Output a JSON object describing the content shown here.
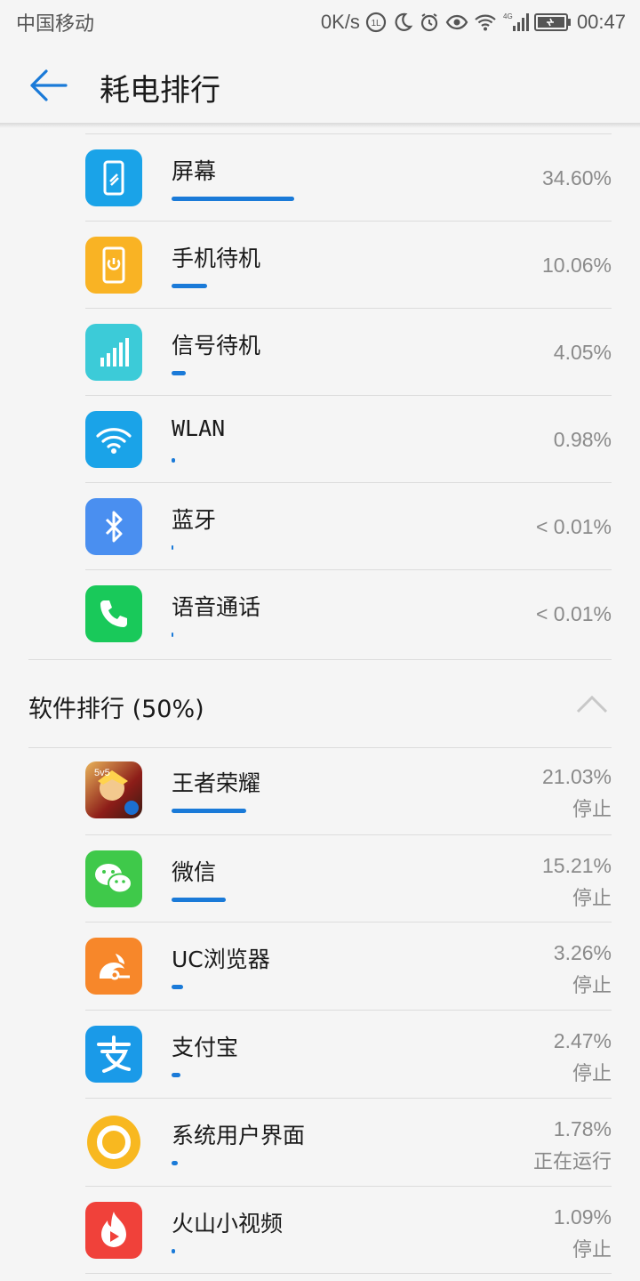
{
  "status_bar": {
    "carrier": "中国移动",
    "speed": "0K/s",
    "network": "4G",
    "time": "00:47"
  },
  "header": {
    "title": "耗电排行"
  },
  "hardware": [
    {
      "name": "屏幕",
      "percent": "34.60%",
      "value": 34.6,
      "icon": "screen-icon",
      "color": "#1aa3e8"
    },
    {
      "name": "手机待机",
      "percent": "10.06%",
      "value": 10.06,
      "icon": "power-icon",
      "color": "#f9b324"
    },
    {
      "name": "信号待机",
      "percent": "4.05%",
      "value": 4.05,
      "icon": "signal-icon",
      "color": "#3ccbd8"
    },
    {
      "name": "WLAN",
      "percent": "0.98%",
      "value": 0.98,
      "icon": "wifi-icon",
      "color": "#1aa3e8"
    },
    {
      "name": "蓝牙",
      "percent": "< 0.01%",
      "value": 0.01,
      "icon": "bluetooth-icon",
      "color": "#4a8ff0"
    },
    {
      "name": "语音通话",
      "percent": "< 0.01%",
      "value": 0.01,
      "icon": "phone-icon",
      "color": "#19c95a"
    }
  ],
  "software_section": {
    "title": "软件排行 (50%)"
  },
  "apps": [
    {
      "name": "王者荣耀",
      "percent": "21.03%",
      "value": 21.03,
      "state": "停止",
      "icon": "honor-of-kings-icon",
      "color": "#b8342a"
    },
    {
      "name": "微信",
      "percent": "15.21%",
      "value": 15.21,
      "state": "停止",
      "icon": "wechat-icon",
      "color": "#3fc94a"
    },
    {
      "name": "UC浏览器",
      "percent": "3.26%",
      "value": 3.26,
      "state": "停止",
      "icon": "uc-browser-icon",
      "color": "#f7872a"
    },
    {
      "name": "支付宝",
      "percent": "2.47%",
      "value": 2.47,
      "state": "停止",
      "icon": "alipay-icon",
      "color": "#1a9ae8"
    },
    {
      "name": "系统用户界面",
      "percent": "1.78%",
      "value": 1.78,
      "state": "正在运行",
      "icon": "system-ui-icon",
      "color": "#f8b820"
    },
    {
      "name": "火山小视频",
      "percent": "1.09%",
      "value": 1.09,
      "state": "停止",
      "icon": "huoshan-video-icon",
      "color": "#f0413a"
    }
  ],
  "colors": {
    "accent": "#1a7ad8",
    "background": "#f5f5f5"
  }
}
